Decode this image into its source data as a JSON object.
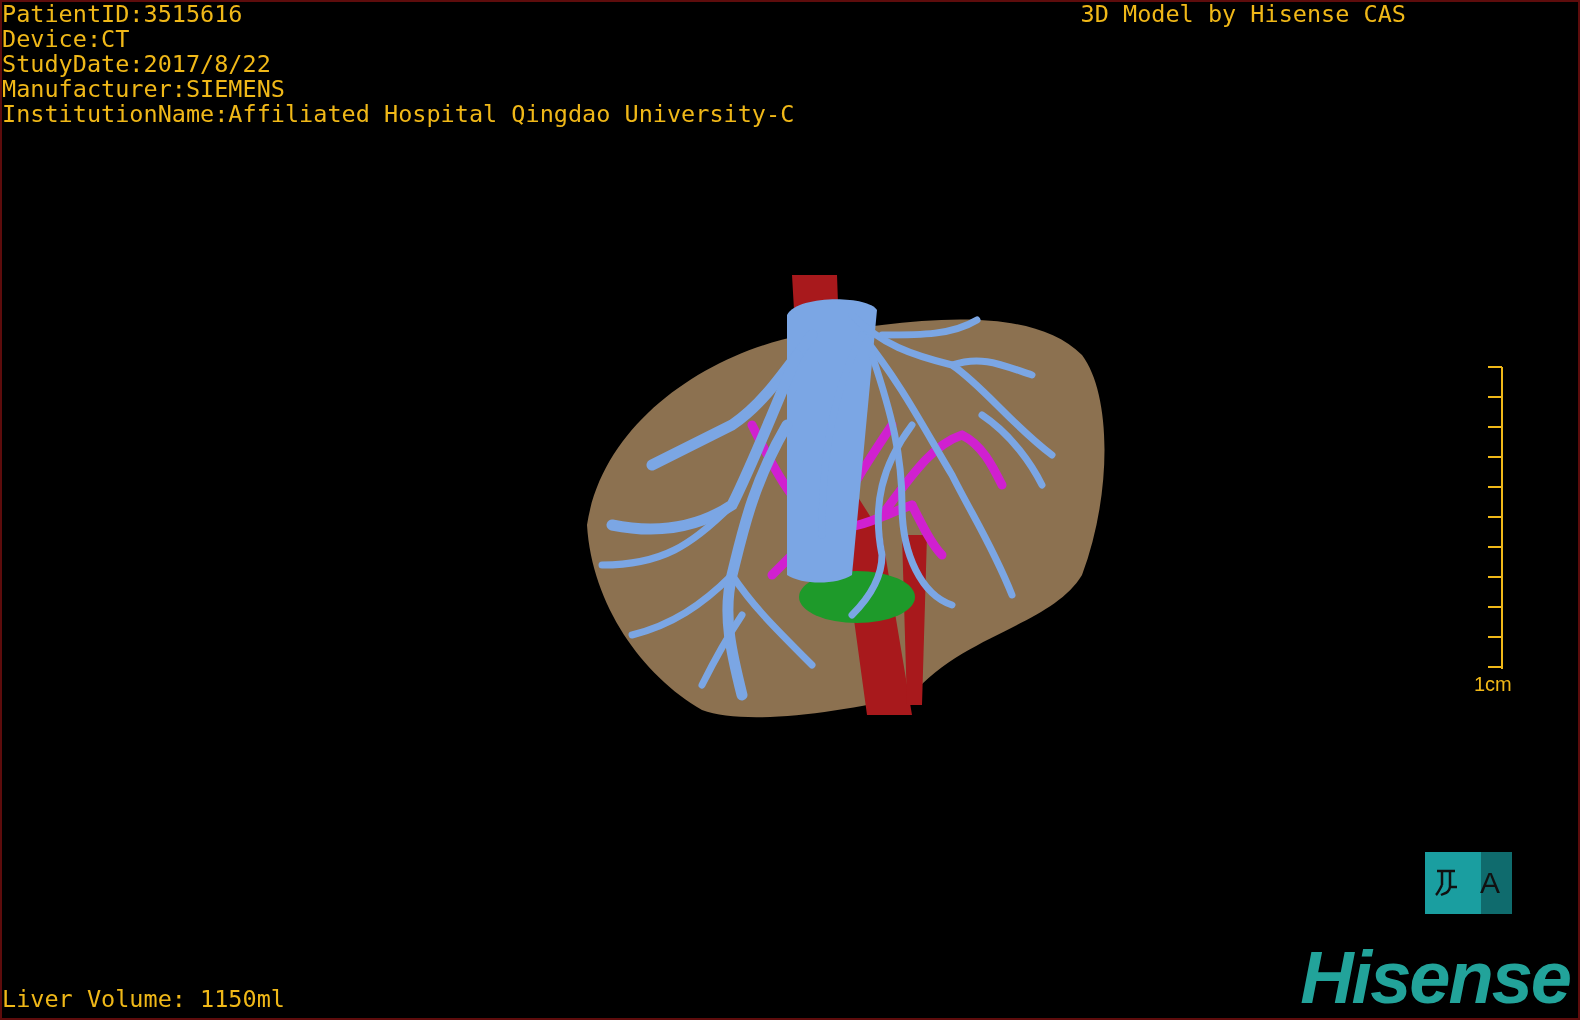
{
  "header": {
    "info_lines": [
      "PatientID:3515616",
      "Device:CT",
      "StudyDate:2017/8/22",
      "Manufacturer:SIEMENS",
      "InstitutionName:Affiliated Hospital Qingdao University-C"
    ],
    "title": "3D Model by Hisense CAS"
  },
  "scale_bar": {
    "label": "1cm"
  },
  "footer": {
    "liver_volume": "Liver Volume: 1150ml",
    "view_button": {
      "label": "A"
    },
    "logo": "Hisense"
  }
}
